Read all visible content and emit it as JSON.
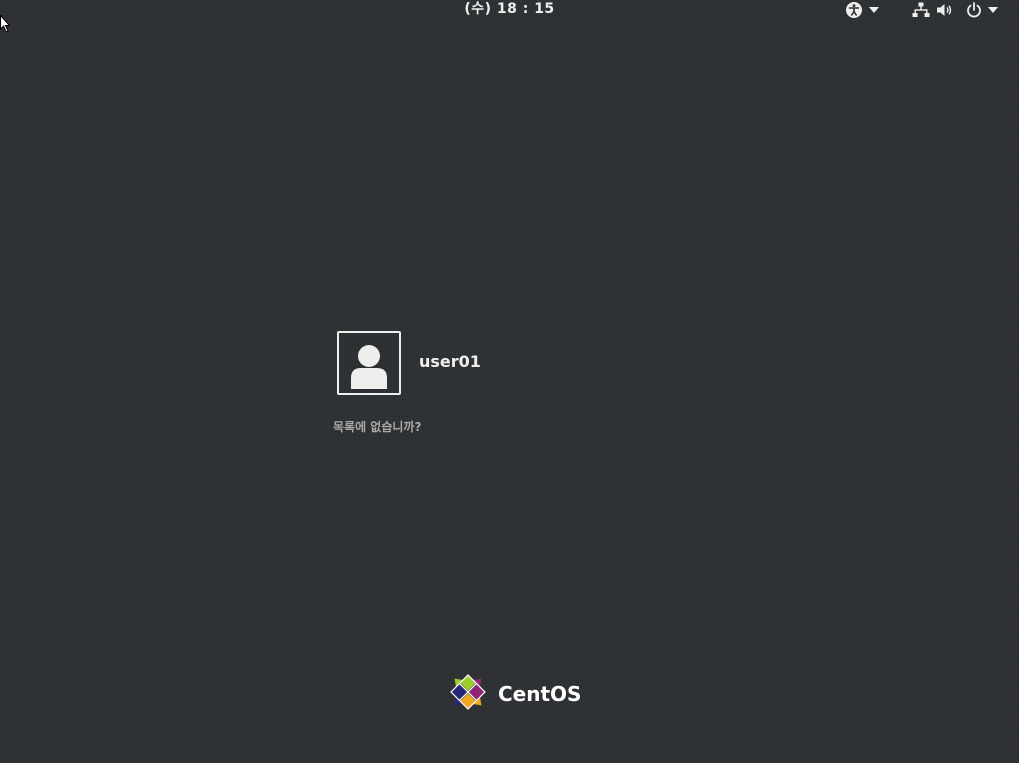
{
  "top_panel": {
    "clock": "(수) 18 : 15",
    "icons": [
      "accessibility-icon",
      "network-icon",
      "volume-icon",
      "power-icon"
    ]
  },
  "user_list": {
    "users": [
      {
        "name": "user01",
        "avatar_icon": "default-user-icon"
      }
    ],
    "not_listed_label": "목록에 없습니까?"
  },
  "logo": {
    "wordmark": "CentOS",
    "colors": [
      "#9ccd2a",
      "#932279",
      "#efa724",
      "#262577"
    ]
  },
  "colors": {
    "background": "#2e3134",
    "text": "#eeeeec",
    "muted_text": "#a8a9a6"
  }
}
